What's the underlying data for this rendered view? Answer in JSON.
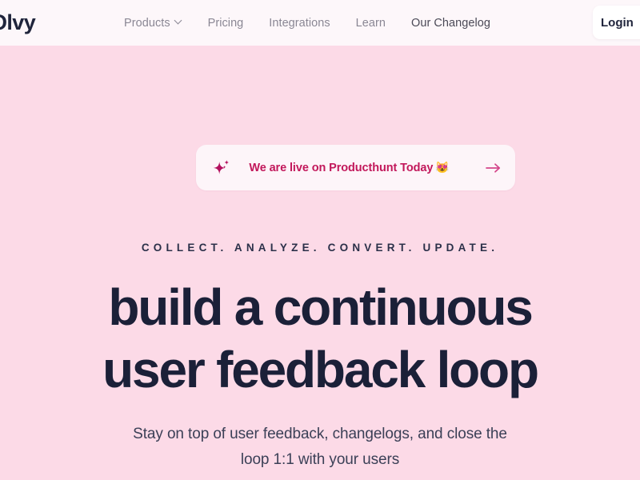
{
  "brand": {
    "logo_text": "Olvy",
    "navy": "#1b2038",
    "hero_bg": "#fcdae7",
    "header_bg": "#fdf7fa",
    "accent_magenta": "#c2185b"
  },
  "header": {
    "nav_items": [
      {
        "label": "Products",
        "has_dropdown": true,
        "icon": "chevron-down-icon",
        "muted": true
      },
      {
        "label": "Pricing",
        "has_dropdown": false,
        "icon": "",
        "muted": true
      },
      {
        "label": "Integrations",
        "has_dropdown": false,
        "icon": "",
        "muted": true
      },
      {
        "label": "Learn",
        "has_dropdown": false,
        "icon": "",
        "muted": true
      },
      {
        "label": "Our Changelog",
        "has_dropdown": false,
        "icon": "",
        "muted": false
      }
    ],
    "login_label": "Login"
  },
  "hero": {
    "announcement": {
      "icon": "sparkle-icon",
      "text": "We are live on Producthunt Today",
      "emoji": "😻",
      "arrow_icon": "arrow-right-icon"
    },
    "eyebrow": "COLLECT. ANALYZE. CONVERT. UPDATE.",
    "headline_line1": "build a continuous",
    "headline_line2": "user feedback loop",
    "subtitle_line1": "Stay on top of user feedback, changelogs, and close the",
    "subtitle_line2": "loop 1:1 with your users"
  }
}
